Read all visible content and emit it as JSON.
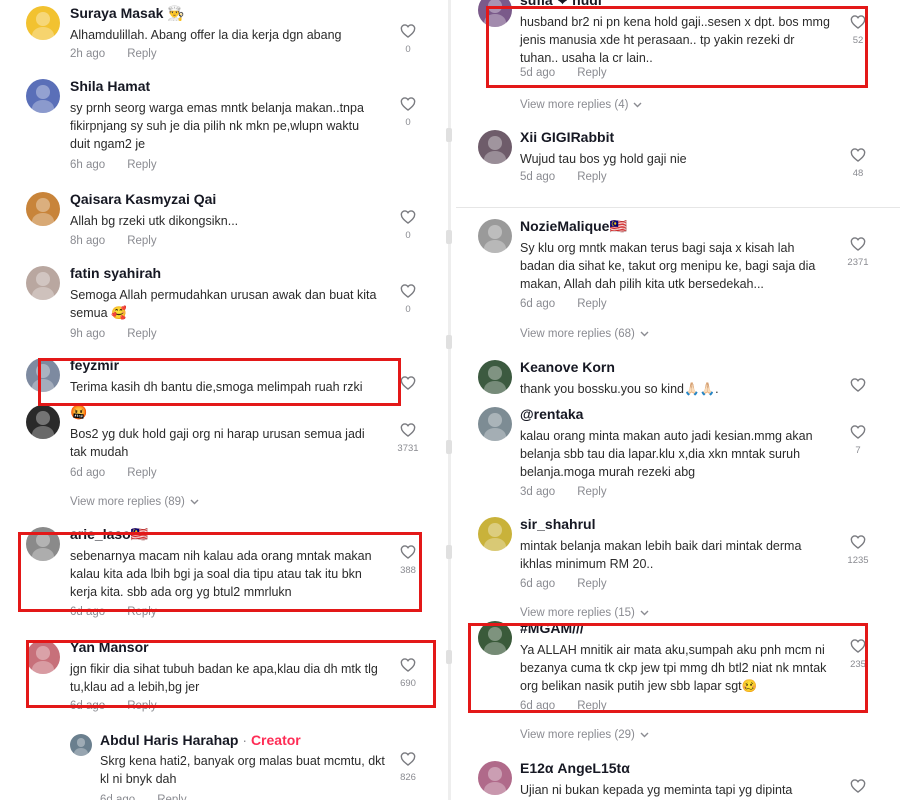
{
  "left_comments": [
    {
      "name": "Suraya Masak 👨‍🍳",
      "text": "Alhamdulillah. Abang offer la dia kerja dgn abang",
      "time": "2h ago",
      "reply": "Reply",
      "likes": "0"
    },
    {
      "name": "Shila Hamat",
      "text": "sy prnh seorg warga emas mntk belanja makan..tnpa fikirpnjang sy suh je dia pilih nk mkn pe,wlupn waktu duit ngam2 je",
      "time": "6h ago",
      "reply": "Reply",
      "likes": "0"
    },
    {
      "name": "Qaisara Kasmyzai Qai",
      "text": "Allah bg rzeki utk dikongsikn...",
      "time": "8h ago",
      "reply": "Reply",
      "likes": "0"
    },
    {
      "name": "fatin syahirah",
      "text": "Semoga Allah permudahkan urusan awak dan buat kita semua 🥰",
      "time": "9h ago",
      "reply": "Reply",
      "likes": "0"
    },
    {
      "name": "feyzmir",
      "text": "Terima kasih dh bantu die,smoga melimpah ruah rzki",
      "time": "",
      "reply": "",
      "likes": ""
    },
    {
      "name": "🤬",
      "text": "Bos2 yg duk hold gaji org ni harap urusan semua jadi tak mudah",
      "time": "6d ago",
      "reply": "Reply",
      "likes": "3731"
    },
    {
      "name": "arie_laso🇲🇾",
      "text": "sebenarnya macam nih kalau ada orang mntak makan kalau kita ada lbih bgi ja soal dia tipu atau tak itu bkn kerja kita. sbb ada org yg btul2 mmrlukn",
      "time": "6d ago",
      "reply": "Reply",
      "likes": "388"
    },
    {
      "name": "Yan Mansor",
      "text": "jgn fikir dia sihat tubuh badan ke apa,klau dia dh mtk tlg tu,klau ad a lebih,bg jer",
      "time": "6d ago",
      "reply": "Reply",
      "likes": "690"
    }
  ],
  "left_view_more": "View more replies (89)",
  "left_reply": {
    "name": "Abdul Haris Harahap",
    "creator_label": "Creator",
    "text": "Skrg kena hati2, banyak org malas buat mcmtu, dkt kl ni bnyk dah",
    "time": "6d ago",
    "reply": "Reply",
    "likes": "826"
  },
  "right_comments": [
    {
      "name": "sufia ❤ hudi",
      "text": "husband br2 ni pn kena hold gaji..sesen x dpt. bos mmg jenis manusia xde ht perasaan.. tp yakin rezeki dr tuhan.. usaha la cr lain..",
      "time": "5d ago",
      "reply": "Reply",
      "likes": "52"
    },
    {
      "name": "Xii GIGIRabbit",
      "text": "Wujud tau bos yg hold gaji nie",
      "time": "5d ago",
      "reply": "Reply",
      "likes": "48"
    },
    {
      "name": "NozieMalique🇲🇾",
      "text": "Sy klu org mntk makan terus bagi saja x kisah lah badan dia sihat ke, takut org menipu ke, bagi saja dia makan, Allah dah pilih kita utk bersedekah...",
      "time": "6d ago",
      "reply": "Reply",
      "likes": "2371"
    },
    {
      "name": "Keanove Korn",
      "text": "thank you bossku.you so kind🙏🏻🙏🏻.",
      "time": "",
      "reply": "",
      "likes": ""
    },
    {
      "name": "@rentaka",
      "text": "kalau orang minta makan auto jadi kesian.mmg akan belanja sbb tau dia lapar.klu x,dia xkn mntak suruh belanja.moga murah rezeki abg",
      "time": "3d ago",
      "reply": "Reply",
      "likes": "7"
    },
    {
      "name": "sir_shahrul",
      "text": "mintak belanja makan lebih baik dari mintak derma ikhlas minimum RM 20..",
      "time": "6d ago",
      "reply": "Reply",
      "likes": "1235"
    },
    {
      "name": "#MGAM///",
      "text": "Ya ALLAH mnitik air mata aku,sumpah aku pnh mcm ni bezanya cuma tk ckp jew tpi mmg dh btl2 niat nk mntak org belikan nasik putih jew sbb lapar sgt🥴",
      "time": "6d ago",
      "reply": "Reply",
      "likes": "235"
    },
    {
      "name": "E12α AngeL15tα",
      "text": "Ujian ni bukan kepada yg meminta tapi yg dipinta",
      "time": "",
      "reply": "",
      "likes": ""
    }
  ],
  "right_view_more": [
    "View more replies (4)",
    "View more replies (68)",
    "View more replies (15)",
    "View more replies (29)"
  ],
  "colors": {
    "highlight": "#e31818",
    "creator": "#fe2c55",
    "muted": "#8a8b91"
  }
}
